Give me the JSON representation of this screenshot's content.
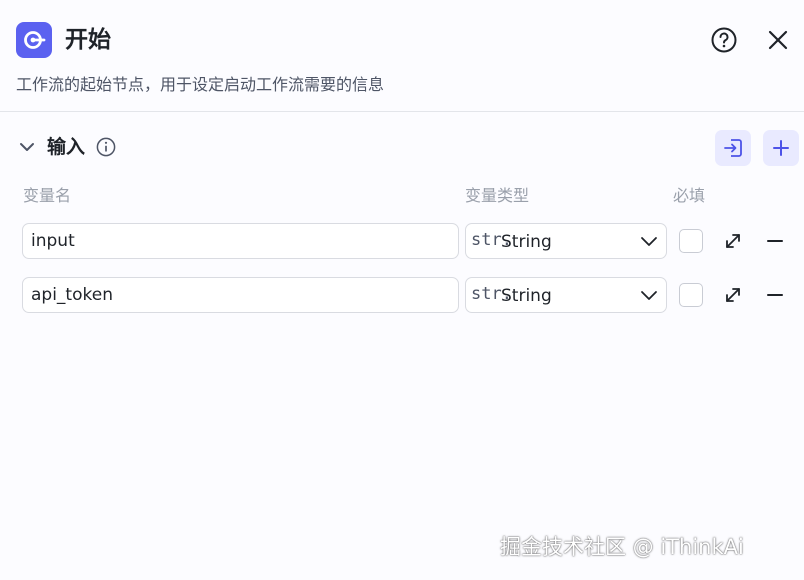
{
  "header": {
    "icon": "start-node-icon",
    "title": "开始",
    "description": "工作流的起始节点，用于设定启动工作流需要的信息",
    "help_icon": "question-circle-icon",
    "close_icon": "close-icon"
  },
  "inputs_section": {
    "title": "输入",
    "info_icon": "info-circle-icon",
    "import_icon": "import-icon",
    "add_icon": "plus-icon",
    "columns": {
      "name": "变量名",
      "type": "变量类型",
      "required": "必填"
    },
    "rows": [
      {
        "name": "input",
        "type_prefix": "str.",
        "type": "String",
        "required": false
      },
      {
        "name": "api_token",
        "type_prefix": "str.",
        "type": "String",
        "required": false
      }
    ]
  },
  "watermark": "掘金技术社区 @ iThinkAi",
  "colors": {
    "accent": "#5b61f0",
    "accent_light": "#e9eaff",
    "border": "#d9dbe1",
    "muted_text": "#9aa0ab"
  }
}
